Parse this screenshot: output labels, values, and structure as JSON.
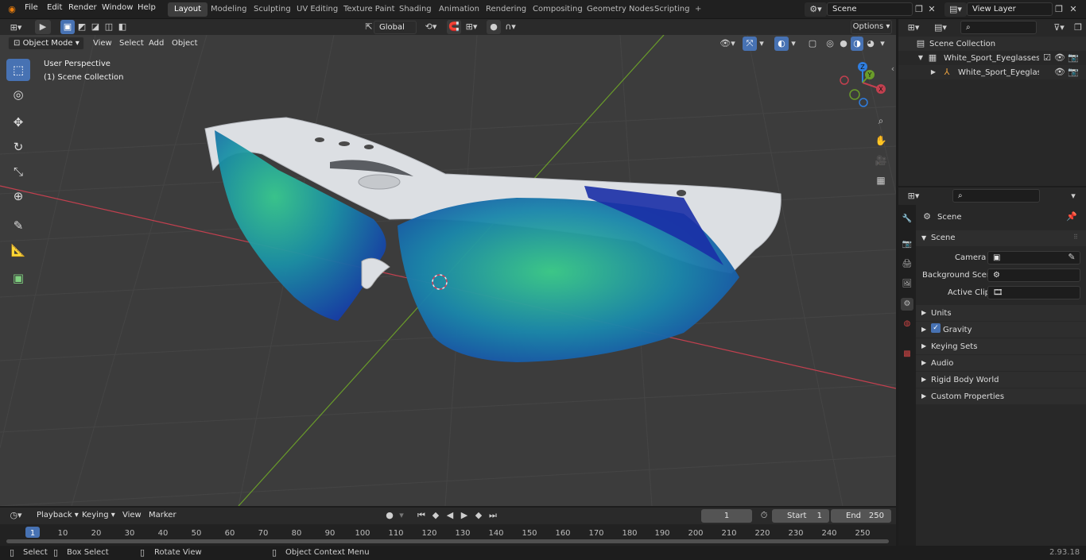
{
  "topbar": {
    "menus": [
      "File",
      "Edit",
      "Render",
      "Window",
      "Help"
    ],
    "workspaces": [
      "Layout",
      "Modeling",
      "Sculpting",
      "UV Editing",
      "Texture Paint",
      "Shading",
      "Animation",
      "Rendering",
      "Compositing",
      "Geometry Nodes",
      "Scripting"
    ],
    "active_workspace": "Layout",
    "add_tab": "+",
    "scene_name": "Scene",
    "view_layer": "View Layer"
  },
  "viewport": {
    "mode": "Object Mode",
    "menus": [
      "View",
      "Select",
      "Add",
      "Object"
    ],
    "transform_orientation": "Global",
    "options_label": "Options",
    "overlay_title": "User Perspective",
    "overlay_collection": "(1) Scene Collection",
    "axes": {
      "x": "X",
      "y": "Y",
      "z": "Z"
    }
  },
  "toolbar": {
    "tools": [
      "select-box",
      "cursor",
      "move",
      "rotate",
      "scale",
      "transform",
      "annotate",
      "measure",
      "add-cube"
    ],
    "active": "select-box"
  },
  "outliner": {
    "root": "Scene Collection",
    "items": [
      {
        "label": "White_Sport_Eyeglasses_Gree",
        "depth": 1
      },
      {
        "label": "White_Sport_Eyeglasses_",
        "depth": 2
      }
    ]
  },
  "properties": {
    "context": "Scene",
    "section": "Scene",
    "fields": [
      {
        "label": "Camera",
        "value": ""
      },
      {
        "label": "Background Scene",
        "value": ""
      },
      {
        "label": "Active Clip",
        "value": ""
      }
    ],
    "panels": [
      "Units",
      "Gravity",
      "Keying Sets",
      "Audio",
      "Rigid Body World",
      "Custom Properties"
    ],
    "gravity_checked": true
  },
  "timeline": {
    "menus": [
      "Playback",
      "Keying",
      "View",
      "Marker"
    ],
    "current_frame": "1",
    "start_label": "Start",
    "start_value": "1",
    "end_label": "End",
    "end_value": "250",
    "ticks": [
      "1",
      "10",
      "20",
      "30",
      "40",
      "50",
      "60",
      "70",
      "80",
      "90",
      "100",
      "110",
      "120",
      "130",
      "140",
      "150",
      "160",
      "170",
      "180",
      "190",
      "200",
      "210",
      "220",
      "230",
      "240",
      "250"
    ]
  },
  "statusbar": {
    "items": [
      "Select",
      "Box Select",
      "Rotate View",
      "Object Context Menu"
    ],
    "version": "2.93.18"
  },
  "colors": {
    "accent": "#4772b3",
    "axis_x": "#c2404f",
    "axis_y": "#6a9c2a",
    "axis_z": "#2f7ee0"
  }
}
